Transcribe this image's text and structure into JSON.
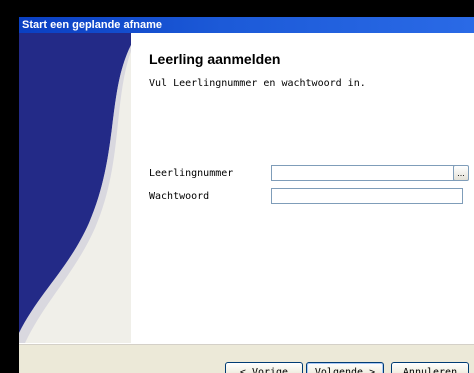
{
  "window": {
    "title": "Start een geplande afname"
  },
  "page": {
    "heading": "Leerling aanmelden",
    "subtitle": "Vul Leerlingnummer en wachtwoord in."
  },
  "form": {
    "student_number_label": "Leerlingnummer",
    "student_number_value": "",
    "password_label": "Wachtwoord",
    "password_value": "",
    "browse_label": "..."
  },
  "buttons": {
    "back": "< Vorige",
    "next": "Volgende >",
    "cancel": "Annuleren"
  },
  "colors": {
    "banner_dark": "#232a87",
    "banner_light": "#f0efe9",
    "title_bar": "#1c5ad8",
    "footer": "#ece9d8"
  }
}
